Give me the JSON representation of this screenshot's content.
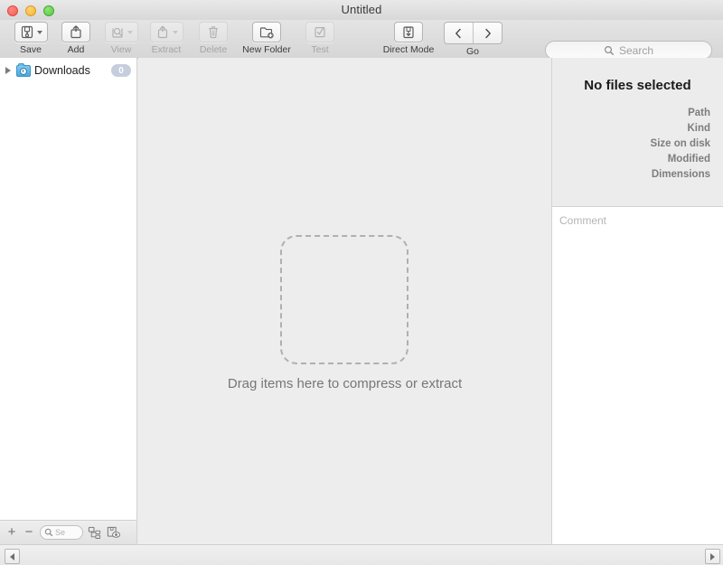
{
  "window": {
    "title": "Untitled",
    "traffic_lights": [
      "close-button",
      "minimize-button",
      "zoom-button"
    ]
  },
  "toolbar": {
    "items": [
      {
        "label": "Save",
        "icon": "archive-save-icon",
        "has_menu": true,
        "enabled": true
      },
      {
        "label": "Add",
        "icon": "add-to-archive-icon",
        "has_menu": false,
        "enabled": true
      },
      {
        "label": "View",
        "icon": "view-magnifier-icon",
        "has_menu": true,
        "enabled": false
      },
      {
        "label": "Extract",
        "icon": "extract-icon",
        "has_menu": true,
        "enabled": false
      },
      {
        "label": "Delete",
        "icon": "trash-icon",
        "has_menu": false,
        "enabled": false
      },
      {
        "label": "New Folder",
        "icon": "new-folder-icon",
        "has_menu": false,
        "enabled": true
      },
      {
        "label": "Test",
        "icon": "test-checkbox-icon",
        "has_menu": false,
        "enabled": false
      },
      {
        "label": "Direct Mode",
        "icon": "direct-mode-icon",
        "has_menu": false,
        "enabled": true
      }
    ],
    "navigation": {
      "label": "Go",
      "back_icon": "chevron-left-icon",
      "forward_icon": "chevron-right-icon"
    },
    "search": {
      "placeholder": "Search",
      "value": "",
      "icon": "search-icon"
    }
  },
  "sidebar": {
    "items": [
      {
        "label": "Downloads",
        "icon": "downloads-folder-icon",
        "badge": "0",
        "expanded": false,
        "disclosure_icon": "disclosure-triangle-icon"
      }
    ],
    "bottom_bar": {
      "add_label": "+",
      "remove_label": "−",
      "search": {
        "placeholder": "Se",
        "value": "",
        "icon": "search-icon"
      },
      "tools": [
        {
          "icon": "hierarchy-view-icon"
        },
        {
          "icon": "archive-preview-icon"
        }
      ]
    }
  },
  "main": {
    "dropzone": {
      "hint": "Drag items here to compress or extract"
    }
  },
  "inspector": {
    "title": "No files selected",
    "fields": [
      {
        "label": "Path",
        "value": ""
      },
      {
        "label": "Kind",
        "value": ""
      },
      {
        "label": "Size on disk",
        "value": ""
      },
      {
        "label": "Modified",
        "value": ""
      },
      {
        "label": "Dimensions",
        "value": ""
      }
    ],
    "comment": {
      "placeholder": "Comment",
      "value": ""
    }
  },
  "scrollbar": {
    "left_icon": "scroll-left-arrow-icon",
    "right_icon": "scroll-right-arrow-icon"
  },
  "colors": {
    "window_chrome": "#e4e4e4",
    "content_bg": "#ededed",
    "sidebar_bg": "#ffffff",
    "badge_bg": "#c6cede",
    "folder_blue": "#4da9e0"
  }
}
